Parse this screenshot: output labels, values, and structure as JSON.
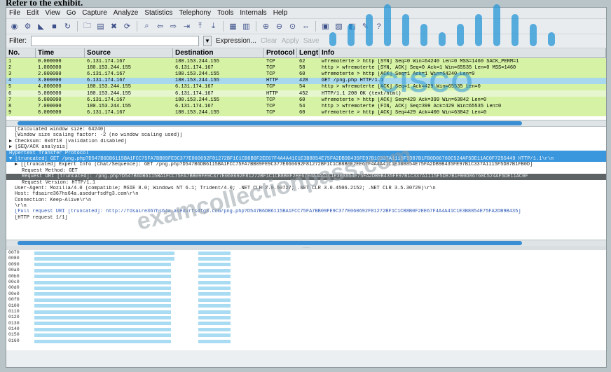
{
  "caption": "Refer to the exhibit.",
  "menu": [
    "File",
    "Edit",
    "View",
    "Go",
    "Capture",
    "Analyze",
    "Statistics",
    "Telephony",
    "Tools",
    "Internals",
    "Help"
  ],
  "toolbar_icons": [
    "interface-list-icon",
    "capture-options-icon",
    "start-capture-icon",
    "stop-capture-icon",
    "restart-capture-icon",
    "open-file-icon",
    "save-file-icon",
    "close-file-icon",
    "reload-icon",
    "find-packet-icon",
    "go-back-icon",
    "go-forward-icon",
    "go-to-packet-icon",
    "go-first-icon",
    "go-last-icon",
    "colorize-icon",
    "auto-scroll-icon",
    "zoom-in-icon",
    "zoom-out-icon",
    "zoom-normal-icon",
    "resize-columns-icon",
    "capture-filters-icon",
    "display-filters-icon",
    "coloring-rules-icon",
    "preferences-icon",
    "help-icon"
  ],
  "filter": {
    "label": "Filter:",
    "value": "",
    "expression": "Expression...",
    "clear": "Clear",
    "apply": "Apply",
    "save": "Save"
  },
  "columns": {
    "no": "No.",
    "time": "Time",
    "source": "Source",
    "destination": "Destination",
    "protocol": "Protocol",
    "length": "Length",
    "info": "Info"
  },
  "packets": [
    {
      "no": "1",
      "time": "0.000000",
      "src": "6.131.174.167",
      "dst": "180.153.244.155",
      "proto": "TCP",
      "len": "62",
      "info": "wfremoterte > http [SYN] Seq=0 Win=64240 Len=0 MSS=1460 SACK_PERM=1",
      "kind": "tcp"
    },
    {
      "no": "2",
      "time": "1.000000",
      "src": "180.153.244.155",
      "dst": "6.131.174.167",
      "proto": "TCP",
      "len": "58",
      "info": "http > wfremoterte [SYN, ACK] Seq=0 Ack=1 Win=65535 Len=0 MSS=1460",
      "kind": "tcp"
    },
    {
      "no": "3",
      "time": "2.000000",
      "src": "6.131.174.167",
      "dst": "180.153.244.155",
      "proto": "TCP",
      "len": "60",
      "info": "wfremoterte > http [ACK] Seq=1 Ack=1 Win=64240 Len=0",
      "kind": "tcp"
    },
    {
      "no": "4",
      "time": "3.000000",
      "src": "6.131.174.167",
      "dst": "180.153.244.155",
      "proto": "HTTP",
      "len": "428",
      "info": "GET /png.php HTTP/1.1",
      "kind": "sel"
    },
    {
      "no": "5",
      "time": "4.000000",
      "src": "180.153.244.155",
      "dst": "6.131.174.167",
      "proto": "TCP",
      "len": "54",
      "info": "http > wfremoterte [ACK] Seq=1 Ack=429 Win=65535 Len=0",
      "kind": "tcp"
    },
    {
      "no": "6",
      "time": "5.000000",
      "src": "180.153.244.155",
      "dst": "6.131.174.167",
      "proto": "HTTP",
      "len": "452",
      "info": "HTTP/1.1 200 OK (text/html)",
      "kind": "http"
    },
    {
      "no": "7",
      "time": "6.000000",
      "src": "6.131.174.167",
      "dst": "180.153.244.155",
      "proto": "TCP",
      "len": "60",
      "info": "wfremoterte > http [ACK] Seq=429 Ack=399 Win=63842 Len=0",
      "kind": "tcp"
    },
    {
      "no": "8",
      "time": "7.000000",
      "src": "180.153.244.155",
      "dst": "6.131.174.167",
      "proto": "TCP",
      "len": "54",
      "info": "http > wfremoterte [FIN, ACK] Seq=399 Ack=429 Win=65535 Len=0",
      "kind": "tcp"
    },
    {
      "no": "9",
      "time": "8.000000",
      "src": "6.131.174.167",
      "dst": "180.153.244.155",
      "proto": "TCP",
      "len": "60",
      "info": "wfremoterte > http [ACK] Seq=429 Ack=400 Win=63842 Len=0",
      "kind": "tcp"
    }
  ],
  "details": [
    {
      "text": "[Calculated window size: 64240]",
      "level": 1,
      "style": ""
    },
    {
      "text": "[Window size scaling factor: -2 (no window scaling used)]",
      "level": 1,
      "style": ""
    },
    {
      "text": "▶ Checksum: 0x6f10 [validation disabled]",
      "level": 0,
      "style": ""
    },
    {
      "text": "▶ [SEQ/ACK analysis]",
      "level": 0,
      "style": ""
    },
    {
      "text": "Hypertext Transfer Protocol",
      "level": 0,
      "style": "dhl"
    },
    {
      "text": "▼ [truncated] GET /png.php?D547B6DB6115BA1FCC75FA7BB09FE9C377E060692F81272BF1C1CB8B0F2EE67F4A4A41C1E3B8854E75FA2DB9B435FE97B1C337A1115F5D87B1FB0D86760C524AF5DE11AC0F7255449 HTTP/1.1\\r\\n",
      "level": 0,
      "style": "dhl"
    },
    {
      "text": "▶ [[truncated] Expert Info (Chat/Sequence): GET /png.php?D547B6DB6115BA1FCC75FA7BB09FE9C377E060692F81272BF1C1CB8B0F2EE67F4A4A41C1E3B8854E75FA2DB9B435FE97B1C337A1115F5D87B1FB0D]",
      "level": 1,
      "style": ""
    },
    {
      "text": "Request Method: GET",
      "level": 2,
      "style": ""
    },
    {
      "text": "Request URI [truncated]: /png.php?D547B6DB6115BA1FCC75FA7BB09FE9C377E060692F81272BF1C1CB8B0F2EE67F4A4A41C1E3B8854E75FA2DB9B435FE97B1C337A1115F5D87B1FB0D86760C524AF5DE11AC0F",
      "level": 2,
      "style": "dsel"
    },
    {
      "text": "Request Version: HTTP/1.1",
      "level": 2,
      "style": ""
    },
    {
      "text": "User-Agent: Mozilla/4.0 (compatible; MSIE 8.0; Windows NT 6.1; Trident/4.0; .NET CLR 2.0.50727; .NET CLR 3.0.4506.2152; .NET CLR 3.5.30729)\\r\\n",
      "level": 1,
      "style": ""
    },
    {
      "text": "Host: fdsaire367hs64a.asedurfsdfg3.com\\r\\n",
      "level": 1,
      "style": ""
    },
    {
      "text": "Connection: Keep-Alive\\r\\n",
      "level": 1,
      "style": ""
    },
    {
      "text": "\\r\\n",
      "level": 1,
      "style": ""
    },
    {
      "text": "[Full request URI [truncated]: http://fdsaire367hs64a.asedurfsdfg3.com/png.php?D547B6DB6115BA1FCC75FA7BB09FE9C377E060692F81272BF1C1CB8B0F2EE67F4A4A41C1E3B8854E75FA2DB9B435]",
      "level": 1,
      "style": "dlink"
    },
    {
      "text": "[HTTP request 1/1]",
      "level": 1,
      "style": ""
    }
  ],
  "byte_offsets": [
    "0070",
    "0080",
    "0090",
    "00a0",
    "00b0",
    "00c0",
    "00d0",
    "00e0",
    "00f0",
    "0100",
    "0110",
    "0120",
    "0130",
    "0140",
    "0150",
    "0160"
  ],
  "watermark": "examcollectionpass.com",
  "logo_text": "CISCO"
}
